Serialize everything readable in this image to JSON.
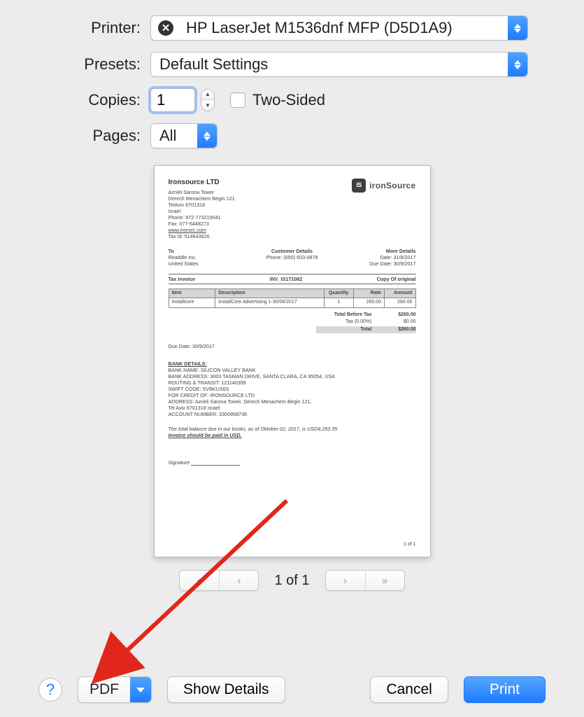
{
  "labels": {
    "printer": "Printer:",
    "presets": "Presets:",
    "copies": "Copies:",
    "pages": "Pages:",
    "two_sided": "Two-Sided"
  },
  "printer": {
    "name": "HP LaserJet M1536dnf MFP (D5D1A9)"
  },
  "presets": {
    "selected": "Default Settings"
  },
  "copies": {
    "value": "1"
  },
  "pages": {
    "selected": "All"
  },
  "nav": {
    "count": "1 of 1"
  },
  "buttons": {
    "pdf": "PDF",
    "show_details": "Show Details",
    "cancel": "Cancel",
    "print": "Print",
    "help": "?"
  },
  "preview": {
    "company": "Ironsource LTD",
    "brand": "ironSource",
    "brand_badge": "iS",
    "addr": {
      "l1": "Azrieli Sarona Tower",
      "l2": "Derech Menachem Begin 121",
      "l3": "TelAviv 6701318",
      "l4": "Israel",
      "phone": "Phone: 972-773219041",
      "fax": "Fax: 077-5448273",
      "site": "www.ironsrc.com",
      "taxid": "Tax Id: 514643626"
    },
    "to": {
      "h": "To",
      "l1": "Readdle Inc.",
      "l2": "United States"
    },
    "cust": {
      "h": "Customer Details",
      "l1": "Phone: (650) 603-0878"
    },
    "more": {
      "h": "More Details",
      "l1": "Date: 31/8/2017",
      "l2": "Due Date: 30/9/2017"
    },
    "bar": {
      "left": "Tax Invoice",
      "mid": "INV_IS171082",
      "right": "Copy Of original"
    },
    "th": {
      "item": "Item",
      "desc": "Description",
      "qty": "Quantity",
      "rate": "Rate",
      "amt": "Amount"
    },
    "row": {
      "item": "Installcore",
      "desc": "installCore Advertising 1-30/06/2017",
      "qty": "1",
      "rate": "260.00",
      "amt": "260.00"
    },
    "totals": {
      "before_k": "Total Before Tax",
      "before_v": "$260.00",
      "tax_k": "Tax (0.00%)",
      "tax_v": "$0.00",
      "total_k": "Total",
      "total_v": "$260.00"
    },
    "due_date": "Due Date: 30/9/2017",
    "bank": {
      "h": "BANK DETAILS:",
      "l1": "BANK NAME: SILICON VALLEY BANK",
      "l2": "BANK ADDRESS: 3003 TASMAN DRIVE, SANTA CLARA, CA 95054, USA",
      "l3": "ROUTING & TRANSIT: 121140399",
      "l4": "SWIFT CODE: SVBKUS6S",
      "l5": "FOR CREDIT OF: IRONSOURCE LTD",
      "l6": "ADDRESS: Azrieli Sarona Tower, Derech Menachem Begin 121,",
      "l7": "Tel Aviv 6701318 Israel",
      "l8": "ACCOUNT NUMBER: 3300958736"
    },
    "balance_line": "The total balance due in our books, as of Oktober 02, 2017, is USD4,293.35",
    "balance_usd": "Invoice should be paid in USD.",
    "signature": "Signature",
    "pagenum": "1 of 1"
  }
}
